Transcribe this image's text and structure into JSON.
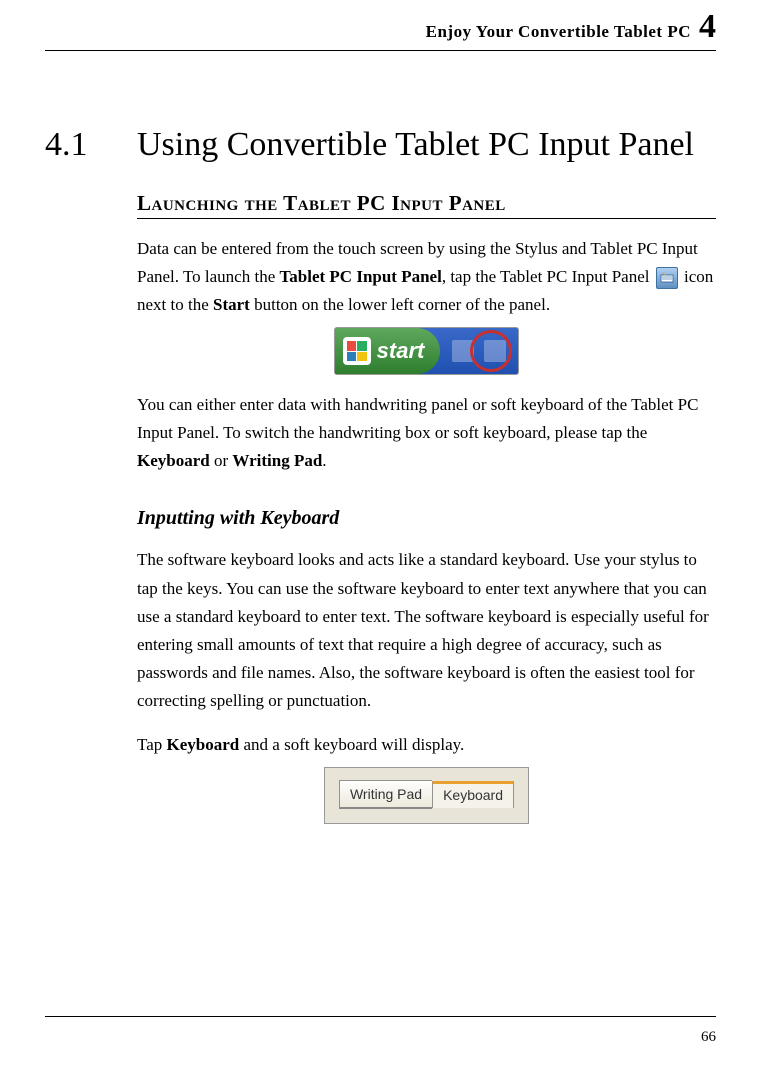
{
  "header": {
    "text": "Enjoy Your Convertible Tablet PC",
    "chapter_num": "4"
  },
  "section": {
    "num": "4.1",
    "title": "Using Convertible Tablet PC Input Panel"
  },
  "sub1": "Launching the Tablet PC Input Panel",
  "para1_a": "Data can be entered from the touch screen by using the Stylus and Tablet PC Input Panel.   To launch the ",
  "para1_b": "Tablet PC Input Panel",
  "para1_c": ", tap the Tablet PC Input Panel ",
  "para1_d": " icon next to the ",
  "para1_e": "Start",
  "para1_f": " button on the lower left corner of the panel.",
  "start_label": "start",
  "para2_a": "You can either enter data with handwriting panel or soft keyboard of the Tablet PC Input Panel. To switch the handwriting box or soft keyboard, please tap the ",
  "para2_b": "Keyboard",
  "para2_c": " or ",
  "para2_d": "Writing Pad",
  "para2_e": ".",
  "sub2": "Inputting with Keyboard",
  "para3": "The software keyboard looks and acts like a standard keyboard. Use your stylus to tap the keys. You can use the software keyboard to enter text anywhere that you can use a standard keyboard to enter text.   The software keyboard is especially useful for entering small amounts of text that require a high degree of accuracy, such as passwords and file names. Also, the software keyboard is often the easiest tool for correcting spelling or punctuation.",
  "para4_a": "Tap ",
  "para4_b": "Keyboard",
  "para4_c": " and a soft keyboard will display.",
  "tabs": {
    "writing": "Writing Pad",
    "keyboard": "Keyboard"
  },
  "page_num": "66"
}
